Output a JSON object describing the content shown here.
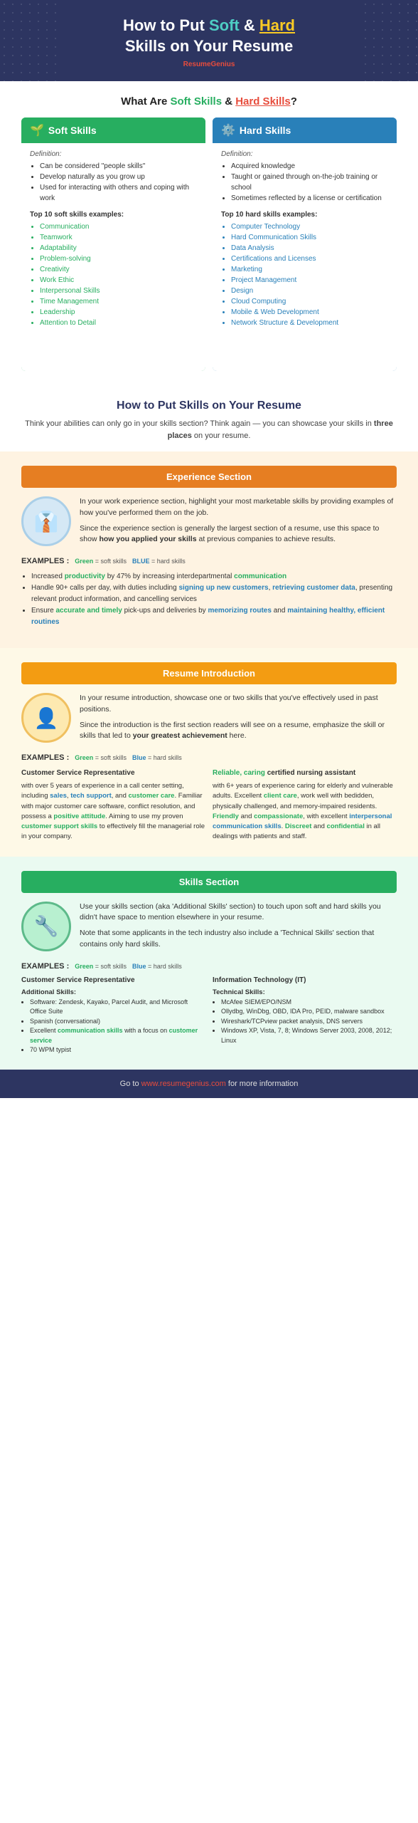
{
  "header": {
    "title_part1": "How to Put ",
    "title_soft": "Soft",
    "title_and": " & ",
    "title_hard": "Hard",
    "title_part2": " Skills on Your Resume",
    "brand_text": "Resume",
    "brand_accent": "Genius"
  },
  "what_section": {
    "title_part1": "What Are ",
    "title_soft": "Soft Skills",
    "title_and": " & ",
    "title_hard": "Hard Skills",
    "title_end": "?",
    "soft_skills": {
      "header": "Soft Skills",
      "icon": "🌱",
      "definition_label": "Definition:",
      "definition_items": [
        "Can be considered \"people skills\"",
        "Develop naturally as you grow up",
        "Used for interacting with others and coping with work"
      ],
      "examples_label": "Top 10 soft skills examples:",
      "examples": [
        "Communication",
        "Teamwork",
        "Adaptability",
        "Problem-solving",
        "Creativity",
        "Work Ethic",
        "Interpersonal Skills",
        "Time Management",
        "Leadership",
        "Attention to Detail"
      ]
    },
    "hard_skills": {
      "header": "Hard Skills",
      "icon": "⚙️",
      "definition_label": "Definition:",
      "definition_items": [
        "Acquired knowledge",
        "Taught or gained through on-the-job training or school",
        "Sometimes reflected by a license or certification"
      ],
      "examples_label": "Top 10 hard skills examples:",
      "examples": [
        "Computer Technology",
        "Hard Communication Skills",
        "Data Analysis",
        "Certifications and Licenses",
        "Marketing",
        "Project Management",
        "Design",
        "Cloud Computing",
        "Mobile & Web Development",
        "Network Structure & Development"
      ]
    }
  },
  "how_section": {
    "title": "How to Put Skills on Your Resume",
    "subtitle": "Think your abilities can only go in your skills section? Think again — you can showcase your skills in",
    "subtitle_bold": "three places",
    "subtitle_end": "on your resume."
  },
  "experience_section": {
    "header": "Experience Section",
    "icon": "👔",
    "para1": "In your work experience section, highlight your most marketable skills by providing examples of how you've performed them on the job.",
    "para2": "Since the experience section is generally the largest section of a resume, use this space to show how you applied your skills at previous companies to achieve results.",
    "examples_label": "EXAMPLES :",
    "legend_green": "Green = soft skills",
    "legend_blue": "BLUE = hard skills",
    "bullets": [
      {
        "text_parts": [
          {
            "text": "Increased ",
            "style": "normal"
          },
          {
            "text": "productivity",
            "style": "green"
          },
          {
            "text": " by 47% by increasing interdepartmental ",
            "style": "normal"
          },
          {
            "text": "communication",
            "style": "green"
          }
        ]
      },
      {
        "text_parts": [
          {
            "text": "Handle 90+ calls per day, with duties including ",
            "style": "normal"
          },
          {
            "text": "signing up new customers",
            "style": "blue"
          },
          {
            "text": ", ",
            "style": "normal"
          },
          {
            "text": "retrieving customer data",
            "style": "blue"
          },
          {
            "text": ", presenting relevant product information, and cancelling services",
            "style": "normal"
          }
        ]
      },
      {
        "text_parts": [
          {
            "text": "Ensure ",
            "style": "normal"
          },
          {
            "text": "accurate and timely",
            "style": "green"
          },
          {
            "text": " pick-ups and deliveries by ",
            "style": "normal"
          },
          {
            "text": "memorizing routes",
            "style": "blue"
          },
          {
            "text": " and ",
            "style": "normal"
          },
          {
            "text": "maintaining healthy, efficient routines",
            "style": "blue"
          }
        ]
      }
    ]
  },
  "resume_intro_section": {
    "header": "Resume Introduction",
    "icon": "👤",
    "para1": "In your resume introduction, showcase one or two skills that you've effectively used in past positions.",
    "para2": "Since the introduction is the first section readers will see on a resume, emphasize the skill or skills that led to your greatest achievement here.",
    "examples_label": "EXAMPLES :",
    "legend_green": "Green = soft skills",
    "legend_blue": "Blue = hard skills",
    "example_left": {
      "title": "Customer Service Representative",
      "body_parts": [
        {
          "text": "with over 5 years of experience in a call center setting, including ",
          "style": "normal"
        },
        {
          "text": "sales",
          "style": "blue"
        },
        {
          "text": ", ",
          "style": "normal"
        },
        {
          "text": "tech support",
          "style": "blue"
        },
        {
          "text": ", and ",
          "style": "normal"
        },
        {
          "text": "customer care",
          "style": "green"
        },
        {
          "text": ". Familiar with major customer care software, conflict resolution, and possess a ",
          "style": "normal"
        },
        {
          "text": "positive attitude",
          "style": "green"
        },
        {
          "text": ". Aiming to use my proven ",
          "style": "normal"
        },
        {
          "text": "customer support skills",
          "style": "green"
        },
        {
          "text": " to effectively fill the managerial role in your company.",
          "style": "normal"
        }
      ]
    },
    "example_right": {
      "title": "Reliable, caring certified nursing assistant",
      "body_parts": [
        {
          "text": " with 6+ years of experience caring for elderly and vulnerable adults. Excellent ",
          "style": "normal"
        },
        {
          "text": "client care",
          "style": "green"
        },
        {
          "text": ", work well with bedidden, physically challenged, and memory-impaired residents. ",
          "style": "normal"
        },
        {
          "text": "Friendly",
          "style": "green"
        },
        {
          "text": " and ",
          "style": "normal"
        },
        {
          "text": "compassionate",
          "style": "green"
        },
        {
          "text": ", with excellent ",
          "style": "normal"
        },
        {
          "text": "interpersonal communication skills",
          "style": "blue"
        },
        {
          "text": ". ",
          "style": "normal"
        },
        {
          "text": "Discreet",
          "style": "green"
        },
        {
          "text": " and ",
          "style": "normal"
        },
        {
          "text": "confidential",
          "style": "green"
        },
        {
          "text": " in all dealings with patients and staff.",
          "style": "normal"
        }
      ]
    }
  },
  "skills_section": {
    "header": "Skills Section",
    "icon": "🔧",
    "para1": "Use your skills section (aka 'Additional Skills' section) to touch upon soft and hard skills you didn't have space to mention elsewhere in your resume.",
    "para2": "Note that some applicants in the tech industry also include a 'Technical Skills' section that contains only hard skills.",
    "examples_label": "EXAMPLES :",
    "legend_green": "Green = soft skills",
    "legend_blue": "Blue = hard skills",
    "example_left": {
      "title": "Customer Service Representative",
      "subtitle": "Additional Skills:",
      "items": [
        {
          "text": "Software: Zendesk, Kayako, Parcel Audit, and Microsoft Office Suite",
          "style": "normal"
        },
        {
          "text": "Spanish (conversational)",
          "style": "normal"
        },
        {
          "text": "Excellent communication skills with a focus on customer service",
          "style": "green_mixed"
        },
        {
          "text": "70 WPM typist",
          "style": "normal"
        }
      ]
    },
    "example_right": {
      "title": "Information Technology (IT)",
      "subtitle": "Technical Skills:",
      "items": [
        {
          "text": "McAfee SIEM/EPO/NSM",
          "style": "normal"
        },
        {
          "text": "Ollydbg, WinDbg, OBD, IDA Pro, PEID, malware sandbox",
          "style": "normal"
        },
        {
          "text": "Wireshark/TCPview packet analysis, DNS servers",
          "style": "normal"
        },
        {
          "text": "Windows XP, Vista, 7, 8; Windows Server 2003, 2008, 2012; Linux",
          "style": "normal"
        }
      ]
    }
  },
  "footer": {
    "text": "Go to ",
    "link": "www.resumegenius.com",
    "text2": " for more information"
  }
}
